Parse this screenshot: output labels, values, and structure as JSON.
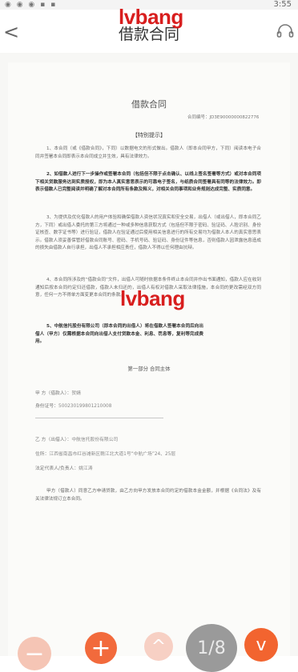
{
  "status_bar": {
    "time": "3:55",
    "icons": "◉ ◉ ◉ ▪ ▪"
  },
  "header": {
    "title": "借款合同",
    "back_glyph": "<",
    "watermark": "lvbang"
  },
  "document": {
    "title": "借款合同",
    "contract_no": "合同编号：JD3E90000000822776",
    "hint_title": "【特别提示】",
    "paragraphs": [
      "1、本合同（或《借款合同》，下同）以数据电文的形式做出。借款人（即本合同甲方，下同）阅读本电子合同并签署本合同即表示本合同成立并生效，具有法律效力。",
      "2、如借款人进行下一步操作或签署本合同（包括但不限于点击确认、以线上签名签署等方式）或对本合同项下相关贷款服务达到实质授权，即为本人真实意思表示的可靠电子签名，与纸质合同签署具有同等的法律效力。即表示借款人已完整阅读并明确了解对本合同所有条款及释义，对相关合同事项和业务规则达成完整、实质同意。",
      "3、为提供及优化借款人的用户体验和确保借款人资信状况真实和安全交易，出借人（或出借人，即本合同乙方，下同）或出借人委托的第三方将通过一种或多种信息获取方式（包括但不限于密码、验证码、人脸识别、身份证核查、数字证书等）进行验证，借款人在验证通过后使用相关信息进行的所有交易均为借款人本人的真实意思表示。借款人须妥善保管好借款合同账号、密码、手机号码、验证码、身份证件等信息，否则借款人因泄露信息造成的损失由借款人自行承担，出借人不承担相应责任，借款人不得以任何理由抗辩。",
      "4、本合同所涉及的“借款合同”文件，出借人可随时依据本条件终止本合同并作出书面通知，借款人应在收到通知后按本合同约定归还借款，借款人未归还的，出借人有权对借款人采取法律措施，本合同的更改需经双方同意，任何一方不得单方面变更本合同的条款。",
      "5、中航信托股份有限公司（即本合同的出借人）将在借款人签署本合同后向出借人（甲方）仅需根据本合同向出借人支付贷款本金、利息、罚息等，复利等完成费用。"
    ],
    "part_one_title": "第一部分   合同主体",
    "borrower_label": "甲  方（借款人）：",
    "borrower_name": "贺婧",
    "borrower_id_label": "身份证号：",
    "borrower_id": "500230199801210008",
    "lender_label": "乙  方（出借人）：",
    "lender_name": "中航信托股份有限公司",
    "lender_addr_label": "住所：",
    "lender_addr": "江西省南昌市红谷滩新区赣江北大道1号“中航广场”24、25层",
    "lender_rep_label": "法定代表人/负责人：",
    "lender_rep": "姚江涛",
    "closing_para": "甲方（借款人）同意乙方申请贷款，由乙方向甲方发放本合同约定的借款本金金额，并根据《合同法》及有关法律法规订立本合同。"
  },
  "watermark_mid": "lvbang",
  "toolbar": {
    "minus": "−",
    "plus": "+",
    "up": "^",
    "page_indicator": "1/8",
    "down": "v"
  },
  "colors": {
    "accent": "#f26a3c",
    "accent_light": "#f5c5b5",
    "watermark": "#d81e1e",
    "page_badge": "#9a9a9a"
  }
}
